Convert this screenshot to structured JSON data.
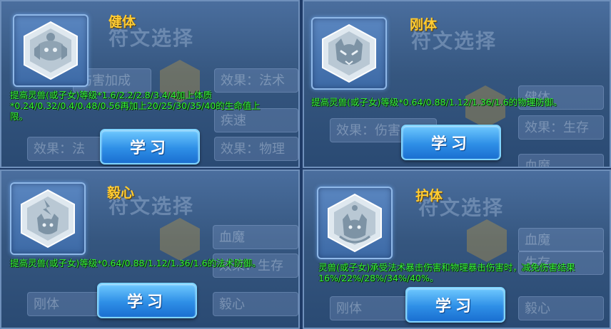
{
  "background": {
    "dialog_title": "符文选择",
    "rows": {
      "damage_bonus": "伤害加成",
      "effect_magic": "效果：法术",
      "effect_magic_short": "效果：法",
      "effect_physical": "效果：物理",
      "effect_survival": "效果：生存",
      "effect_damage": "效果：伤害",
      "haste": "疾速",
      "robust": "健体",
      "devil": "血魔",
      "survival": "生存",
      "gangti": "刚体",
      "yixin": "毅心",
      "huti": "护体"
    }
  },
  "cards": [
    {
      "title": "健体",
      "description": "提高灵兽(或子女)等级*1.6/2.2/2.8/3.4/4加上体质*0.24/0.32/0.4/0.48/0.56再加上20/25/30/35/40的生命值上限。",
      "button_label": "学习",
      "icon": "beast-crest-icon"
    },
    {
      "title": "刚体",
      "description": "提高灵兽(或子女)等级*0.64/0.88/1.12/1.36/1.6的物理防御。",
      "button_label": "学习",
      "icon": "cat-shield-icon"
    },
    {
      "title": "毅心",
      "description": "提高灵兽(或子女)等级*0.64/0.88/1.12/1.36/1.6的法术防御。",
      "button_label": "学习",
      "icon": "cat-flame-icon"
    },
    {
      "title": "护体",
      "description": "灵兽(或子女)承受法术暴击伤害和物理暴击伤害时，减免伤害结果16%/22%/28%/34%/40%。",
      "button_label": "学习",
      "icon": "cat-guard-icon"
    }
  ],
  "colors": {
    "title": "#ffcc33",
    "description": "#36f23a",
    "button": "#2e8fe6",
    "emblem_border": "#8fb8e8"
  }
}
